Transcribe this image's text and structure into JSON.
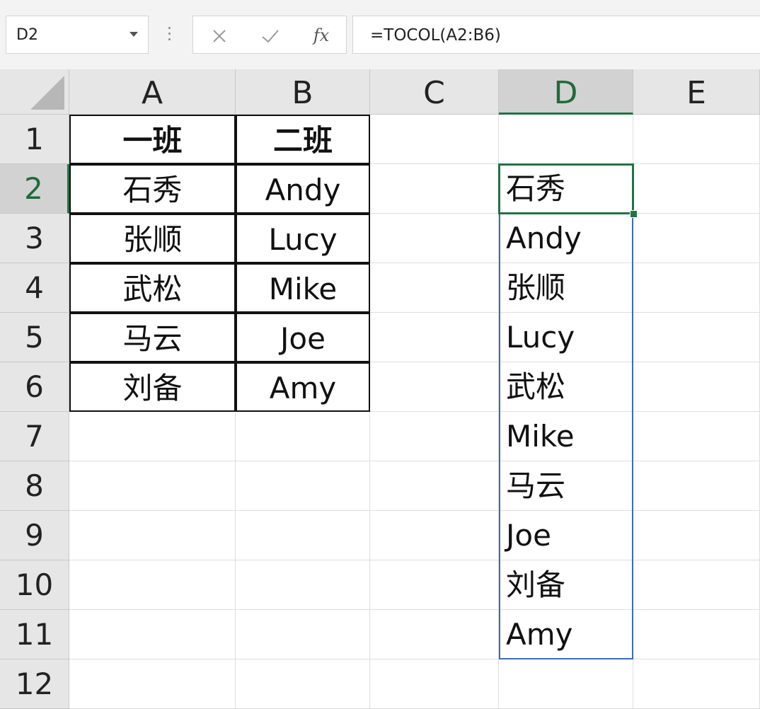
{
  "formula_bar": {
    "name_box": "D2",
    "cancel_icon": "close-icon",
    "enter_icon": "check-icon",
    "fx_label": "fx",
    "formula": "=TOCOL(A2:B6)"
  },
  "columns": [
    "A",
    "B",
    "C",
    "D",
    "E"
  ],
  "active_column": "D",
  "rows": [
    "1",
    "2",
    "3",
    "4",
    "5",
    "6",
    "7",
    "8",
    "9",
    "10",
    "11",
    "12"
  ],
  "active_row": "2",
  "table": {
    "headers": [
      "一班",
      "二班"
    ],
    "rows": [
      [
        "石秀",
        "Andy"
      ],
      [
        "张顺",
        "Lucy"
      ],
      [
        "武松",
        "Mike"
      ],
      [
        "马云",
        "Joe"
      ],
      [
        "刘备",
        "Amy"
      ]
    ]
  },
  "result_column": [
    "石秀",
    "Andy",
    "张顺",
    "Lucy",
    "武松",
    "Mike",
    "马云",
    "Joe",
    "刘备",
    "Amy"
  ],
  "colors": {
    "selection": "#217346",
    "spill_border": "#3a6db5",
    "header_bg": "#e6e6e6"
  }
}
